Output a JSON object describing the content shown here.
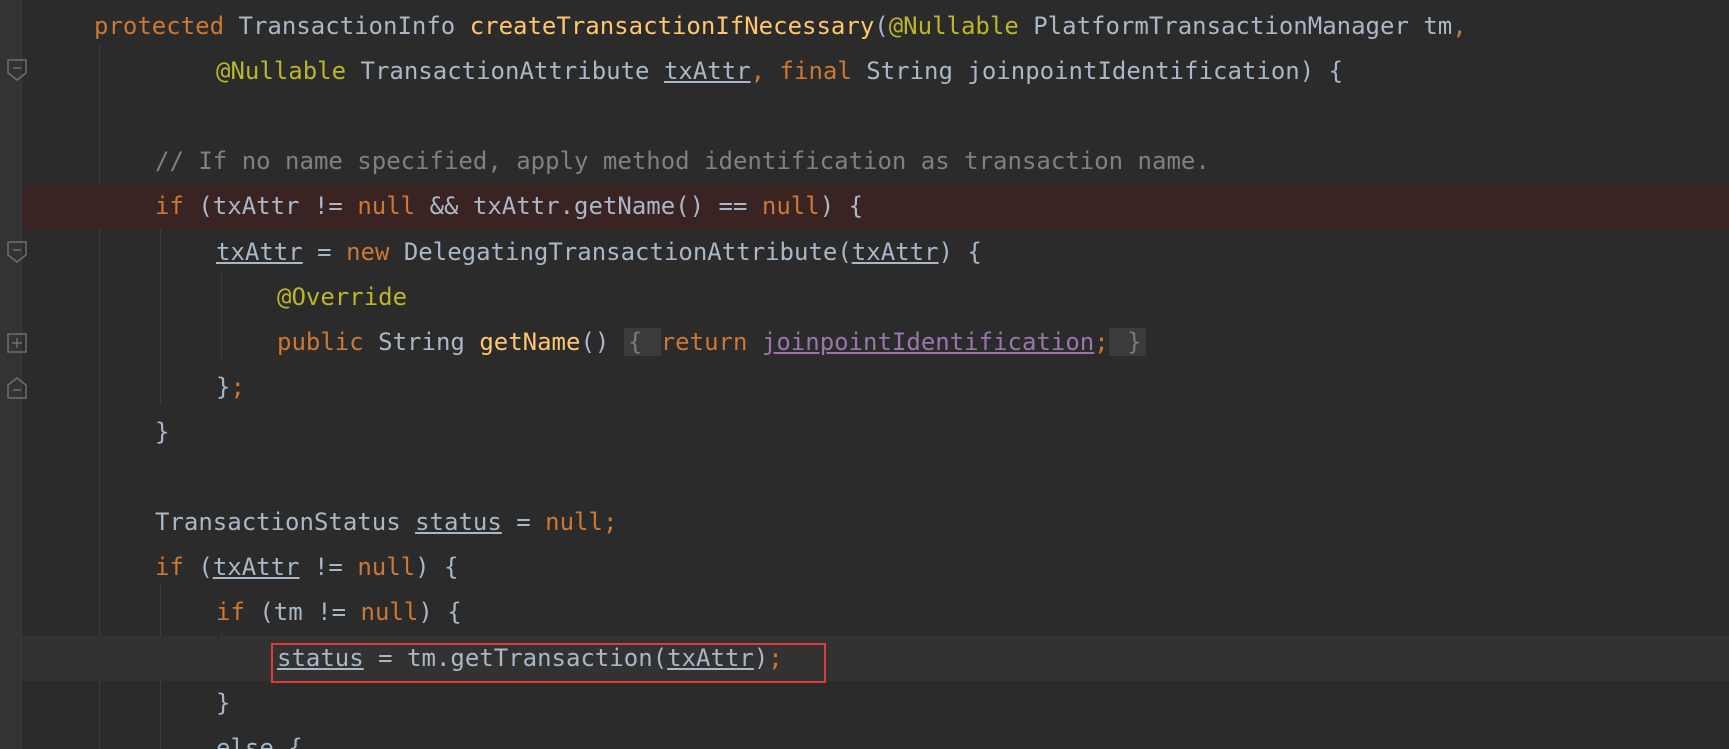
{
  "editor": {
    "lines": [
      {
        "id": "l1",
        "tokens": [
          {
            "t": "protected ",
            "c": "kw"
          },
          {
            "t": "TransactionInfo ",
            "c": ""
          },
          {
            "t": "createTransactionIfNecessary",
            "c": "fn"
          },
          {
            "t": "(",
            "c": ""
          },
          {
            "t": "@Nullable ",
            "c": "ann"
          },
          {
            "t": "PlatformTransactionManager tm",
            "c": ""
          },
          {
            "t": ",",
            "c": "kw"
          }
        ]
      },
      {
        "id": "l2",
        "tokens": [
          {
            "t": "@Nullable ",
            "c": "ann"
          },
          {
            "t": "TransactionAttribute ",
            "c": ""
          },
          {
            "t": "txAttr",
            "c": "ul"
          },
          {
            "t": ", ",
            "c": "kw"
          },
          {
            "t": "final ",
            "c": "kw"
          },
          {
            "t": "String joinpointIdentification) {",
            "c": ""
          }
        ]
      },
      {
        "id": "l4",
        "tokens": [
          {
            "t": "// If no name specified, apply method identification as transaction name.",
            "c": "cm"
          }
        ]
      },
      {
        "id": "l5",
        "tokens": [
          {
            "t": "if ",
            "c": "kw"
          },
          {
            "t": "(txAttr != ",
            "c": ""
          },
          {
            "t": "null ",
            "c": "kw"
          },
          {
            "t": "&& txAttr.getName() == ",
            "c": ""
          },
          {
            "t": "null",
            "c": "kw"
          },
          {
            "t": ") {",
            "c": ""
          }
        ]
      },
      {
        "id": "l6",
        "tokens": [
          {
            "t": "txAttr",
            "c": "ul"
          },
          {
            "t": " = ",
            "c": ""
          },
          {
            "t": "new ",
            "c": "kw"
          },
          {
            "t": "DelegatingTransactionAttribute(",
            "c": ""
          },
          {
            "t": "txAttr",
            "c": "ul"
          },
          {
            "t": ") {",
            "c": ""
          }
        ]
      },
      {
        "id": "l7",
        "tokens": [
          {
            "t": "@Override",
            "c": "ann"
          }
        ]
      },
      {
        "id": "l8",
        "tokens": [
          {
            "t": "public ",
            "c": "kw"
          },
          {
            "t": "String ",
            "c": ""
          },
          {
            "t": "getName",
            "c": "fn"
          },
          {
            "t": "() ",
            "c": ""
          },
          {
            "t": "{ ",
            "c": "foldbox"
          },
          {
            "t": "return ",
            "c": "kw"
          },
          {
            "t": "joinpointIdentification",
            "c": "field"
          },
          {
            "t": ";",
            "c": "kw"
          },
          {
            "t": " }",
            "c": "foldbox"
          }
        ]
      },
      {
        "id": "l9",
        "tokens": [
          {
            "t": "}",
            "c": ""
          },
          {
            "t": ";",
            "c": "kw"
          }
        ]
      },
      {
        "id": "l10",
        "tokens": [
          {
            "t": "}",
            "c": ""
          }
        ]
      },
      {
        "id": "l12",
        "tokens": [
          {
            "t": "TransactionStatus ",
            "c": ""
          },
          {
            "t": "status",
            "c": "ul"
          },
          {
            "t": " = ",
            "c": ""
          },
          {
            "t": "null",
            "c": "kw"
          },
          {
            "t": ";",
            "c": "kw"
          }
        ]
      },
      {
        "id": "l13",
        "tokens": [
          {
            "t": "if ",
            "c": "kw"
          },
          {
            "t": "(",
            "c": ""
          },
          {
            "t": "txAttr",
            "c": "ul"
          },
          {
            "t": " != ",
            "c": ""
          },
          {
            "t": "null",
            "c": "kw"
          },
          {
            "t": ") {",
            "c": ""
          }
        ]
      },
      {
        "id": "l14",
        "tokens": [
          {
            "t": "if ",
            "c": "kw"
          },
          {
            "t": "(tm != ",
            "c": ""
          },
          {
            "t": "null",
            "c": "kw"
          },
          {
            "t": ") {",
            "c": ""
          }
        ]
      },
      {
        "id": "l15",
        "tokens": [
          {
            "t": "status",
            "c": "ul"
          },
          {
            "t": " = tm.getTransaction(",
            "c": ""
          },
          {
            "t": "txAttr",
            "c": "ul"
          },
          {
            "t": ")",
            "c": ""
          },
          {
            "t": ";",
            "c": "kw"
          }
        ]
      },
      {
        "id": "l16",
        "tokens": [
          {
            "t": "}",
            "c": ""
          }
        ]
      },
      {
        "id": "l17",
        "tokens": [
          {
            "t": "else {",
            "c": ""
          }
        ]
      }
    ]
  },
  "colors": {
    "background": "#2b2b2b",
    "keyword": "#cc7832",
    "function": "#ffc66d",
    "annotation": "#bbb529",
    "comment": "#808080",
    "field": "#9876aa",
    "text": "#a9b7c6",
    "breakpoint_line": "#3a2323",
    "highlight_box": "#e03b3b"
  }
}
